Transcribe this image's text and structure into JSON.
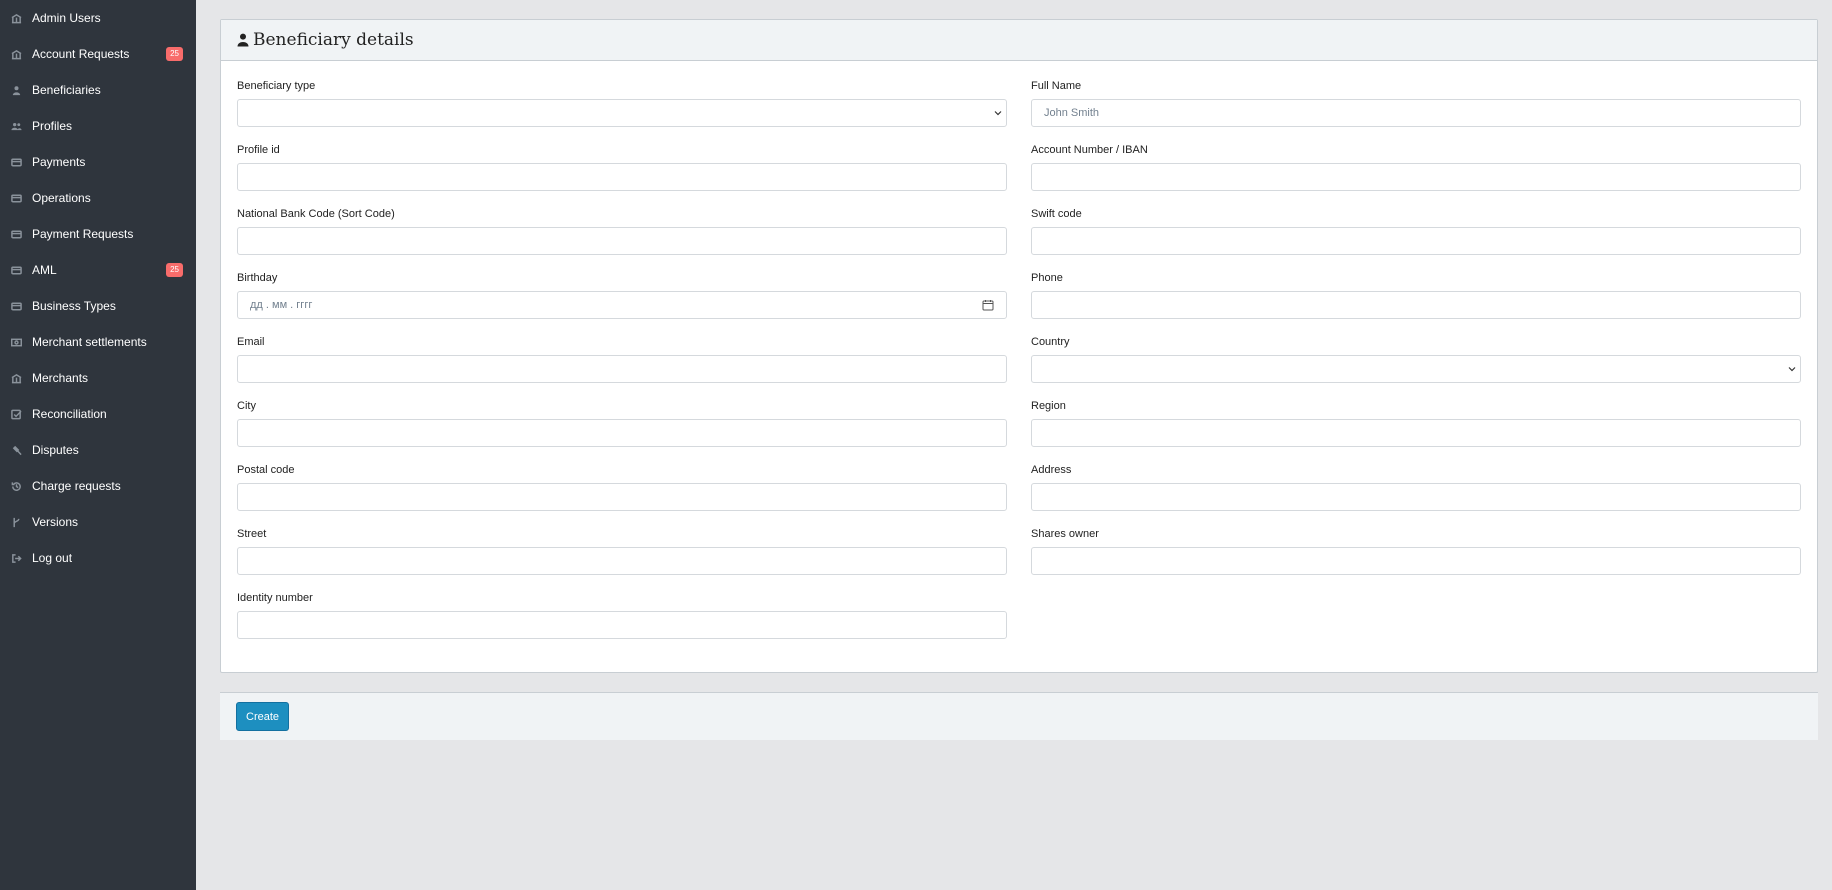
{
  "sidebar": {
    "items": [
      {
        "label": "Admin Users",
        "icon": "bank-icon"
      },
      {
        "label": "Account Requests",
        "icon": "bank-icon",
        "badge": "25"
      },
      {
        "label": "Beneficiaries",
        "icon": "user-icon"
      },
      {
        "label": "Profiles",
        "icon": "people-icon"
      },
      {
        "label": "Payments",
        "icon": "credit-card-icon"
      },
      {
        "label": "Operations",
        "icon": "credit-card-icon"
      },
      {
        "label": "Payment Requests",
        "icon": "credit-card-icon"
      },
      {
        "label": "AML",
        "icon": "credit-card-icon",
        "badge": "25"
      },
      {
        "label": "Business Types",
        "icon": "credit-card-icon"
      },
      {
        "label": "Merchant settlements",
        "icon": "money-icon"
      },
      {
        "label": "Merchants",
        "icon": "bank-icon"
      },
      {
        "label": "Reconciliation",
        "icon": "check-square-icon"
      },
      {
        "label": "Disputes",
        "icon": "gavel-icon"
      },
      {
        "label": "Charge requests",
        "icon": "history-icon"
      },
      {
        "label": "Versions",
        "icon": "branch-icon"
      },
      {
        "label": "Log out",
        "icon": "logout-icon"
      }
    ]
  },
  "card": {
    "title": "Beneficiary details",
    "icon": "user-icon"
  },
  "fields": {
    "beneficiary_type": {
      "label": "Beneficiary type",
      "value": ""
    },
    "full_name": {
      "label": "Full Name",
      "placeholder": "John Smith"
    },
    "profile_id": {
      "label": "Profile id",
      "value": ""
    },
    "account_number": {
      "label": "Account Number / IBAN",
      "value": ""
    },
    "national_bank_code": {
      "label": "National Bank Code (Sort Code)",
      "value": ""
    },
    "swift_code": {
      "label": "Swift code",
      "value": ""
    },
    "birthday": {
      "label": "Birthday",
      "placeholder": "дд . мм . гггг"
    },
    "phone": {
      "label": "Phone",
      "value": ""
    },
    "email": {
      "label": "Email",
      "value": ""
    },
    "country": {
      "label": "Country",
      "value": ""
    },
    "city": {
      "label": "City",
      "value": ""
    },
    "region": {
      "label": "Region",
      "value": ""
    },
    "postal_code": {
      "label": "Postal code",
      "value": ""
    },
    "address": {
      "label": "Address",
      "value": ""
    },
    "street": {
      "label": "Street",
      "value": ""
    },
    "shares_owner": {
      "label": "Shares owner",
      "value": ""
    },
    "identity_number": {
      "label": "Identity number",
      "value": ""
    }
  },
  "footer": {
    "create_label": "Create"
  },
  "colors": {
    "sidebar_bg": "#2f353d",
    "badge": "#f86c6b",
    "primary_button": "#1d8fc0"
  }
}
